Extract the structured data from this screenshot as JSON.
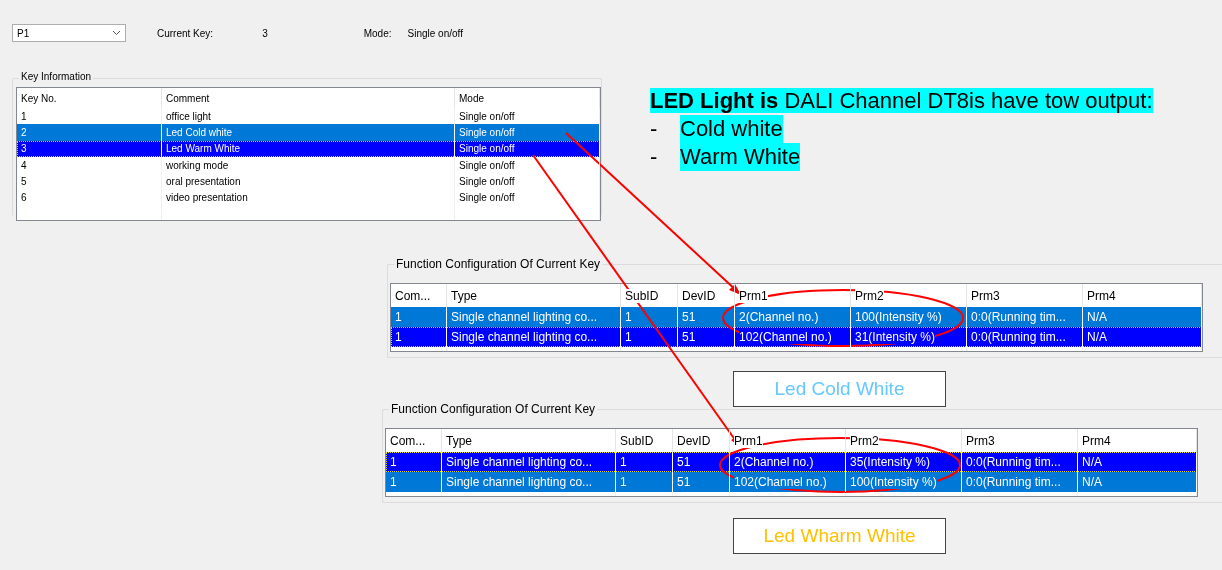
{
  "toolbar": {
    "page_select": {
      "value": "P1"
    },
    "current_key_label": "Current Key:",
    "current_key": "3",
    "mode_label": "Mode:",
    "mode": "Single on/off"
  },
  "key_information": {
    "title": "Key Information",
    "columns": [
      "Key No.",
      "Comment",
      "Mode"
    ],
    "rows": [
      {
        "cells": [
          "1",
          "office light",
          "Single on/off"
        ],
        "selected": false,
        "focused": false
      },
      {
        "cells": [
          "2",
          "Led Cold white",
          "Single on/off"
        ],
        "selected": true,
        "focused": false
      },
      {
        "cells": [
          "3",
          "Led Warm White",
          "Single on/off"
        ],
        "selected": true,
        "focused": true
      },
      {
        "cells": [
          "4",
          "working mode",
          "Single on/off"
        ],
        "selected": false,
        "focused": false
      },
      {
        "cells": [
          "5",
          "oral presentation",
          "Single on/off"
        ],
        "selected": false,
        "focused": false
      },
      {
        "cells": [
          "6",
          "video presentation",
          "Single on/off"
        ],
        "selected": false,
        "focused": false
      }
    ]
  },
  "note": {
    "heading": "**LED Light is** DALI Channel DT8is have tow output:",
    "items": [
      {
        "bullet": "-",
        "text": "Cold white"
      },
      {
        "bullet": "-",
        "text": "Warm White"
      }
    ]
  },
  "configs": [
    {
      "title": "Function Configuration Of Current Key",
      "columns": [
        "Com...",
        "Type",
        "SubID",
        "DevID",
        "Prm1",
        "Prm2",
        "Prm3",
        "Prm4"
      ],
      "rows": [
        {
          "cells": [
            "1",
            "Single channel lighting co...",
            "1",
            "51",
            "2(Channel no.)",
            "100(Intensity %)",
            "0:0(Running tim...",
            "N/A"
          ],
          "selected": true,
          "focused": false
        },
        {
          "cells": [
            "1",
            "Single channel lighting co...",
            "1",
            "51",
            "102(Channel no.)",
            "31(Intensity %)",
            "0:0(Running tim...",
            "N/A"
          ],
          "selected": true,
          "focused": true
        }
      ],
      "caption": {
        "text": "Led Cold White",
        "color": "#66c8ff"
      }
    },
    {
      "title": "Function Configuration Of Current Key",
      "columns": [
        "Com...",
        "Type",
        "SubID",
        "DevID",
        "Prm1",
        "Prm2",
        "Prm3",
        "Prm4"
      ],
      "rows": [
        {
          "cells": [
            "1",
            "Single channel lighting co...",
            "1",
            "51",
            "2(Channel no.)",
            "35(Intensity %)",
            "0:0(Running tim...",
            "N/A"
          ],
          "selected": true,
          "focused": true
        },
        {
          "cells": [
            "1",
            "Single channel lighting co...",
            "1",
            "51",
            "102(Channel no.)",
            "100(Intensity %)",
            "0:0(Running tim...",
            "N/A"
          ],
          "selected": true,
          "focused": false
        }
      ],
      "caption": {
        "text": "Led Wharm White",
        "color": "#ffc000"
      }
    }
  ]
}
